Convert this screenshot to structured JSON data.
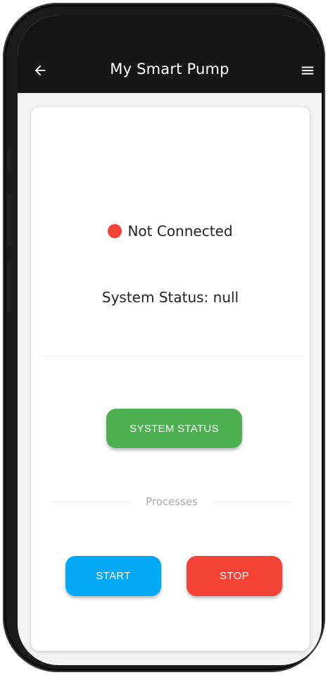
{
  "app_bar": {
    "title": "My Smart Pump"
  },
  "connection": {
    "status_text": "Not Connected",
    "indicator_color": "#f44336"
  },
  "system": {
    "status_text": "System Status: null"
  },
  "buttons": {
    "system_status": "SYSTEM STATUS",
    "start": "START",
    "stop": "STOP"
  },
  "processes": {
    "label": "Processes"
  },
  "colors": {
    "app_bar": "#161616",
    "system_status_button": "#4caf50",
    "start_button": "#03a9f4",
    "stop_button": "#f44336"
  },
  "icons": {
    "back": "arrow-left-icon",
    "menu": "hamburger-menu-icon"
  }
}
